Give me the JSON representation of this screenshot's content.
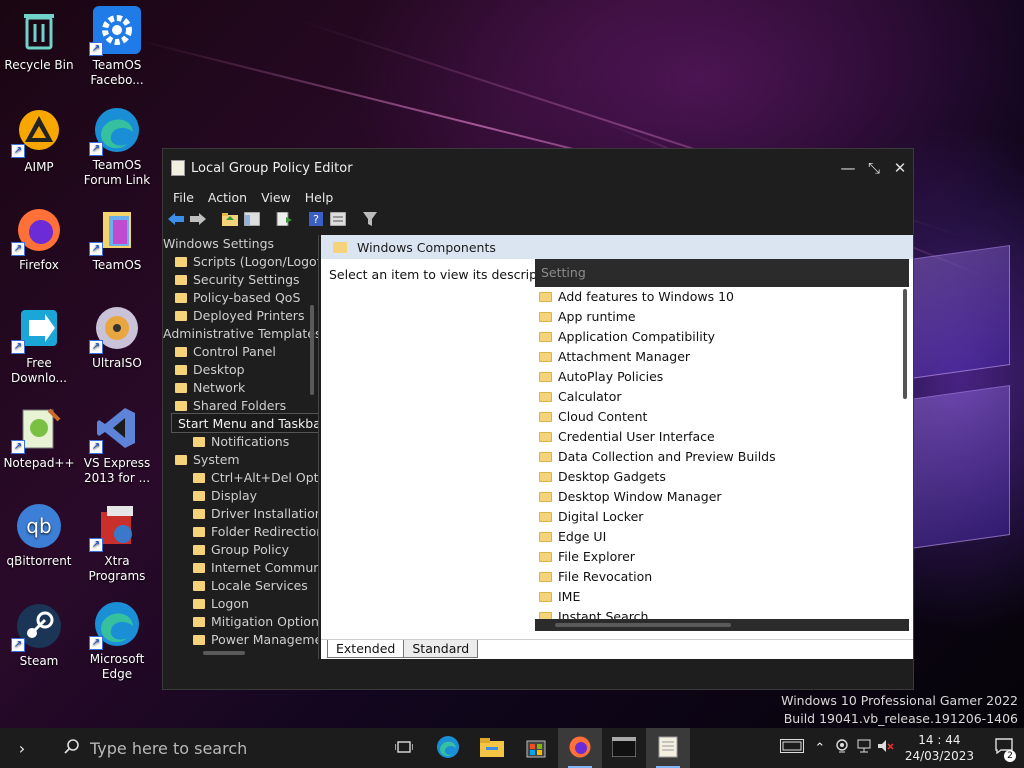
{
  "desktop": {
    "icons": [
      {
        "label": "Recycle Bin",
        "icon": "recycle-bin-icon"
      },
      {
        "label": "TeamOS Facebo...",
        "icon": "gear-icon"
      },
      {
        "label": "AIMP",
        "icon": "aimp-icon"
      },
      {
        "label": "TeamOS Forum Link",
        "icon": "edge-icon"
      },
      {
        "label": "Firefox",
        "icon": "firefox-icon"
      },
      {
        "label": "TeamOS",
        "icon": "folder-icon"
      },
      {
        "label": "Free Downlo...",
        "icon": "download-icon"
      },
      {
        "label": "UltraISO",
        "icon": "disc-icon"
      },
      {
        "label": "Notepad++",
        "icon": "notepad-icon"
      },
      {
        "label": "VS Express 2013 for ...",
        "icon": "visual-studio-icon"
      },
      {
        "label": "qBittorrent",
        "icon": "qbittorrent-icon"
      },
      {
        "label": "Xtra Programs",
        "icon": "programs-icon"
      },
      {
        "label": "Steam",
        "icon": "steam-icon"
      },
      {
        "label": "Microsoft Edge",
        "icon": "edge-icon"
      }
    ]
  },
  "window": {
    "title": "Local Group Policy Editor",
    "controls": {
      "minimize": "—",
      "maximize": "⤡",
      "close": "✕"
    },
    "menu": [
      "File",
      "Action",
      "View",
      "Help"
    ],
    "tree": [
      {
        "label": "Windows Settings",
        "indent": 0
      },
      {
        "label": "Scripts (Logon/Logoff",
        "indent": 1
      },
      {
        "label": "Security Settings",
        "indent": 1
      },
      {
        "label": "Policy-based QoS",
        "indent": 1
      },
      {
        "label": "Deployed Printers",
        "indent": 1
      },
      {
        "label": "Administrative Templates",
        "indent": 0
      },
      {
        "label": "Control Panel",
        "indent": 1
      },
      {
        "label": "Desktop",
        "indent": 1
      },
      {
        "label": "Network",
        "indent": 1
      },
      {
        "label": "Shared Folders",
        "indent": 1
      },
      {
        "label": "Start Menu and Taskbar",
        "indent": 1
      },
      {
        "label": "Notifications",
        "indent": 2
      },
      {
        "label": "System",
        "indent": 1
      },
      {
        "label": "Ctrl+Alt+Del Optic",
        "indent": 2
      },
      {
        "label": "Display",
        "indent": 2
      },
      {
        "label": "Driver Installation",
        "indent": 2
      },
      {
        "label": "Folder Redirection",
        "indent": 2
      },
      {
        "label": "Group Policy",
        "indent": 2
      },
      {
        "label": "Internet Communic",
        "indent": 2
      },
      {
        "label": "Locale Services",
        "indent": 2
      },
      {
        "label": "Logon",
        "indent": 2
      },
      {
        "label": "Mitigation Options",
        "indent": 2
      },
      {
        "label": "Power Manageme",
        "indent": 2
      }
    ],
    "tooltip": "Start Menu and Taskbar",
    "right_header": "Windows Components",
    "description": "Select an item to view its description.",
    "list_header": "Setting",
    "items": [
      "Add features to Windows 10",
      "App runtime",
      "Application Compatibility",
      "Attachment Manager",
      "AutoPlay Policies",
      "Calculator",
      "Cloud Content",
      "Credential User Interface",
      "Data Collection and Preview Builds",
      "Desktop Gadgets",
      "Desktop Window Manager",
      "Digital Locker",
      "Edge UI",
      "File Explorer",
      "File Revocation",
      "IME",
      "Instant Search"
    ],
    "tabs": [
      "Extended",
      "Standard"
    ]
  },
  "watermark": {
    "line1": "Windows 10 Professional Gamer 2022",
    "line2": "Build 19041.vb_release.191206-1406"
  },
  "taskbar": {
    "search_placeholder": "Type here to search",
    "time": "14 : 44",
    "date": "24/03/2023",
    "notification_count": "2"
  }
}
